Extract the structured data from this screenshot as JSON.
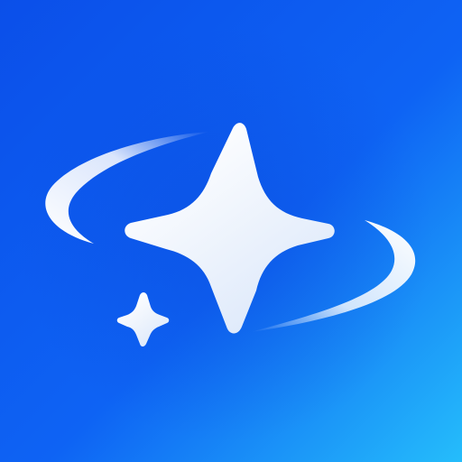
{
  "icon": {
    "name": "sparkle-orbit-app-icon",
    "shape": "rounded-square",
    "glyphs": [
      "large-four-point-star",
      "small-four-point-star",
      "orbit-swoosh"
    ]
  },
  "colors": {
    "background_top_left": "#0B4FE9",
    "background_mid": "#0E63F4",
    "background_bottom_right": "#25BDFB",
    "star_light": "#FFFFFF",
    "star_shade": "#DCE8FA",
    "swoosh": "#FFFFFF"
  }
}
